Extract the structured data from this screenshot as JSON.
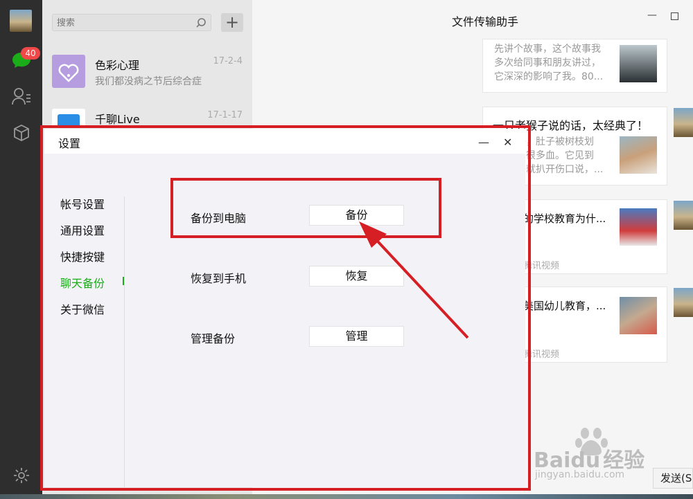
{
  "sidebar": {
    "unread_badge": "40",
    "icons": [
      "avatar",
      "chat-icon",
      "contacts-icon",
      "favorites-icon",
      "settings-gear-icon"
    ]
  },
  "chat_list": {
    "search_placeholder": "搜索",
    "add_label": "+",
    "items": [
      {
        "name": "色彩心理",
        "date": "17-2-4",
        "snippet": "我们都没病之节后综合症"
      },
      {
        "name": "千聊Live",
        "date": "17-1-17",
        "snippet": ""
      }
    ]
  },
  "conversation": {
    "title": "文件传输助手",
    "cards": [
      {
        "title": "",
        "text": "先讲个故事，这个故事我\n多次给同事和朋友讲过，\n它深深的影响了我。80..."
      },
      {
        "title": "一只老猴子说的话，太经典了！",
        "text": "子，肚子被树枝划\n了很多血。它见到\n子就扒开伤口说，..."
      },
      {
        "title": "的学校教育为什...",
        "text": "",
        "footer": "腾讯视频"
      },
      {
        "title": "美国幼儿教育，...",
        "text": "",
        "footer": "腾讯视频"
      }
    ],
    "send_label": "发送(S"
  },
  "watermark": {
    "brand": "Baidu",
    "product": "经验",
    "url": "jingyan.baidu.com"
  },
  "settings_dialog": {
    "title": "设置",
    "minimize": "—",
    "close": "✕",
    "nav": [
      {
        "label": "帐号设置"
      },
      {
        "label": "通用设置"
      },
      {
        "label": "快捷按键"
      },
      {
        "label": "聊天备份",
        "active": true
      },
      {
        "label": "关于微信"
      }
    ],
    "rows": [
      {
        "label": "备份到电脑",
        "button": "备份"
      },
      {
        "label": "恢复到手机",
        "button": "恢复"
      },
      {
        "label": "管理备份",
        "button": "管理"
      }
    ]
  },
  "colors": {
    "accent_green": "#1aad19",
    "annotation_red": "#d51f25",
    "badge_red": "#f04848"
  }
}
